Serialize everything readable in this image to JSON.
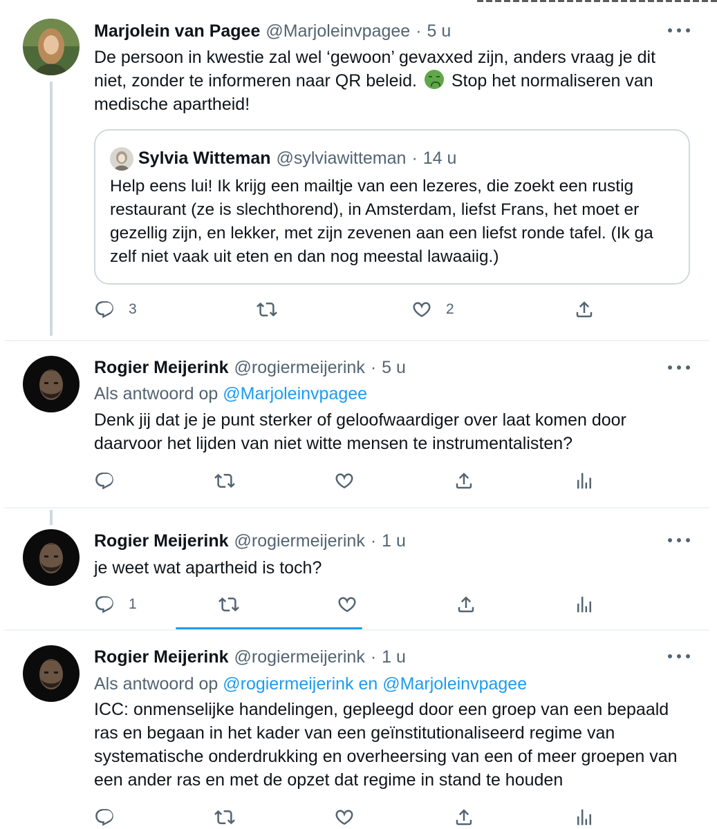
{
  "tweets": [
    {
      "name": "Marjolein van Pagee",
      "handle": "@Marjoleinvpagee",
      "time": "5 u",
      "text_a": "De persoon in kwestie zal wel ‘gewoon’ gevaxxed zijn, anders vraag je dit niet, zonder te informeren naar QR beleid.",
      "emoji": "nauseated-face",
      "text_b": "Stop het normaliseren van medische apartheid!",
      "quote": {
        "name": "Sylvia Witteman",
        "handle": "@sylviawitteman",
        "time": "14 u",
        "text": "Help eens lui! Ik krijg een mailtje van een lezeres, die zoekt een rustig restaurant (ze is slechthorend), in Amsterdam, liefst Frans, het moet er gezellig zijn, en lekker, met zijn zevenen aan een liefst ronde tafel. (Ik ga zelf niet vaak uit eten en dan nog meestal lawaaiig.)"
      },
      "replies": "3",
      "likes": "2"
    },
    {
      "name": "Rogier Meijerink",
      "handle": "@rogiermeijerink",
      "time": "5 u",
      "reply_prefix": "Als antwoord op",
      "reply_mention": "@Marjoleinvpagee",
      "text": "Denk jij dat je je punt sterker of geloofwaardiger over laat komen door daarvoor het lijden van niet witte mensen te instrumentalisten?"
    },
    {
      "name": "Rogier Meijerink",
      "handle": "@rogiermeijerink",
      "time": "1 u",
      "text": "je weet wat apartheid is toch?",
      "replies": "1"
    },
    {
      "name": "Rogier Meijerink",
      "handle": "@rogiermeijerink",
      "time": "1 u",
      "reply_prefix": "Als antwoord op",
      "reply_mention_1": "@rogiermeijerink",
      "reply_and": "en",
      "reply_mention_2": "@Marjoleinvpagee",
      "text": "ICC: onmenselijke handelingen, gepleegd door een groep van een bepaald ras en begaan in het kader van een geïnstitutionaliseerd regime van systematische onderdrukking en overheersing van een of meer groepen van een ander ras en met de opzet dat regime in stand te houden"
    }
  ],
  "separator_dot": "·",
  "icons": [
    "reply-icon",
    "retweet-icon",
    "like-icon",
    "share-icon",
    "analytics-icon",
    "more-icon"
  ],
  "colors": {
    "link": "#1d9bf0",
    "secondary_text": "#536471",
    "primary_text": "#0f1419",
    "border": "#cfd9de"
  }
}
